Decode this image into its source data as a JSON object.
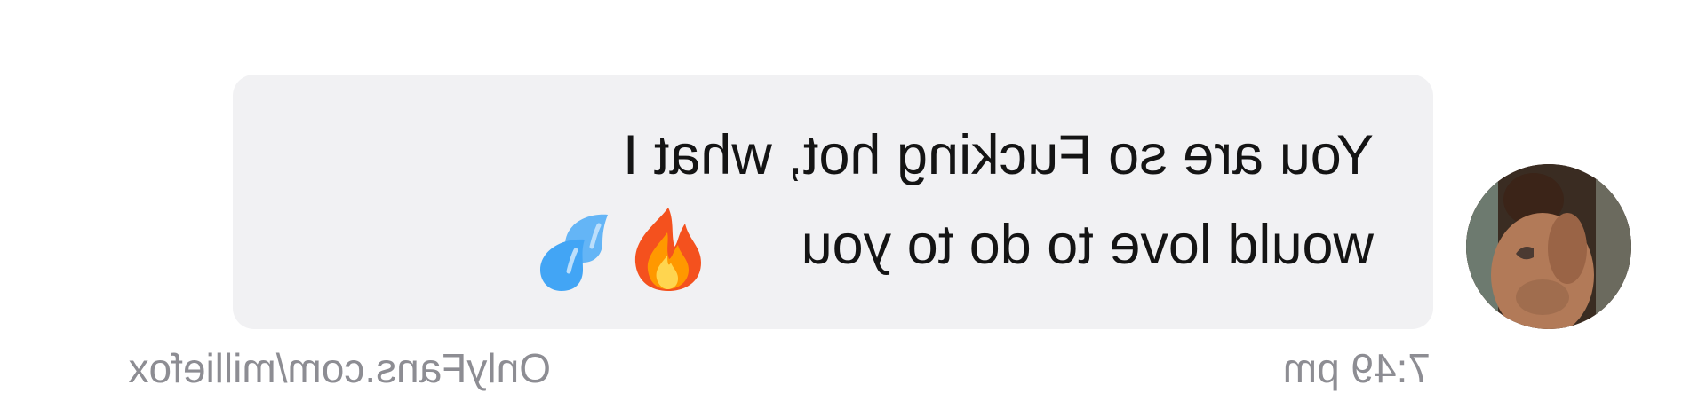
{
  "conversation": {
    "message": {
      "line1": "You are so Fucking hot, what I",
      "line2": "would love to do to you",
      "emojis": [
        "fire-icon",
        "sweat-droplets-icon"
      ],
      "time": "7:49 pm"
    },
    "sender": {
      "avatar": "profile-photo"
    }
  },
  "watermark": "OnlyFans.com/milliefox",
  "display": {
    "mirrored": true
  },
  "colors": {
    "bubble": "#f1f1f3",
    "text": "#141414",
    "meta_text": "#8d8d93",
    "background": "#ffffff"
  }
}
